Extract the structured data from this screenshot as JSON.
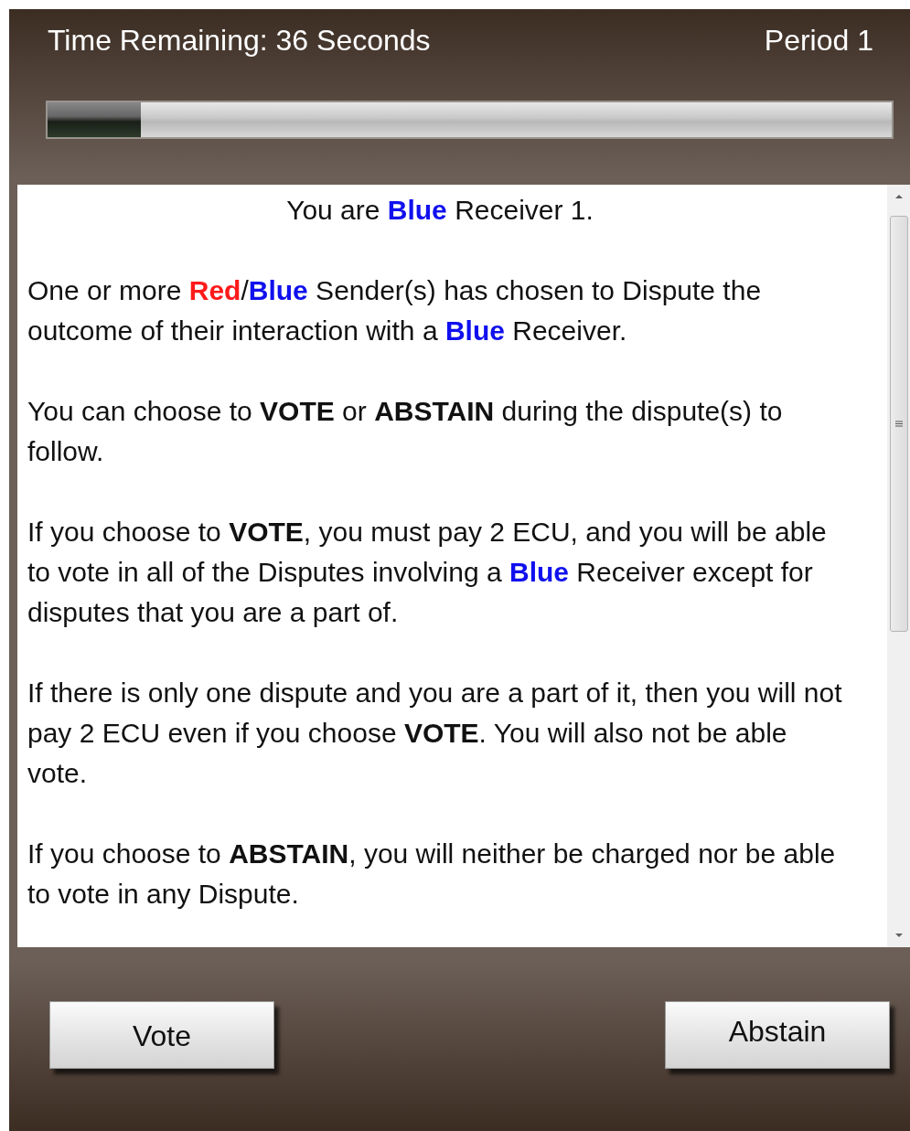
{
  "header": {
    "time_remaining": "Time Remaining: 36 Seconds",
    "period": "Period 1"
  },
  "timer": {
    "level": 0.11
  },
  "message": {
    "paragraphs": [
      {
        "kind": "heading",
        "segments": [
          {
            "kind": "plain",
            "text": "You are "
          },
          {
            "kind": "team_blue",
            "text": "Blue"
          },
          {
            "kind": "plain",
            "text": " Receiver 1."
          }
        ]
      },
      {
        "kind": "body",
        "segments": [
          {
            "kind": "plain",
            "text": "One or more "
          },
          {
            "kind": "team_red",
            "text": "Red"
          },
          {
            "kind": "plain",
            "text": "/"
          },
          {
            "kind": "team_blue",
            "text": "Blue"
          },
          {
            "kind": "plain",
            "text": " Sender(s) has chosen to Dispute the outcome of their interaction with a "
          },
          {
            "kind": "team_blue",
            "text": "Blue"
          },
          {
            "kind": "plain",
            "text": " Receiver."
          }
        ]
      },
      {
        "kind": "body",
        "segments": [
          {
            "kind": "plain",
            "text": "You can choose to "
          },
          {
            "kind": "strong",
            "text": "VOTE"
          },
          {
            "kind": "plain",
            "text": " or "
          },
          {
            "kind": "strong",
            "text": "ABSTAIN"
          },
          {
            "kind": "plain",
            "text": " during the dispute(s) to follow."
          }
        ]
      },
      {
        "kind": "body",
        "segments": [
          {
            "kind": "plain",
            "text": "If you choose to "
          },
          {
            "kind": "strong",
            "text": "VOTE"
          },
          {
            "kind": "plain",
            "text": ", you must pay 2 ECU, and you will be able to vote in all of the Disputes involving a "
          },
          {
            "kind": "team_blue",
            "text": "Blue"
          },
          {
            "kind": "plain",
            "text": " Receiver except for disputes that you are a part of."
          }
        ]
      },
      {
        "kind": "body",
        "segments": [
          {
            "kind": "plain",
            "text": "If there is only one dispute and you are a part of it, then you will not pay 2 ECU even if you choose "
          },
          {
            "kind": "strong",
            "text": "VOTE"
          },
          {
            "kind": "plain",
            "text": ". You will also not be able vote."
          }
        ]
      },
      {
        "kind": "body",
        "segments": [
          {
            "kind": "plain",
            "text": "If you choose to "
          },
          {
            "kind": "strong",
            "text": "ABSTAIN"
          },
          {
            "kind": "plain",
            "text": ", you will neither be charged nor be able to vote in any Dispute."
          }
        ]
      }
    ]
  },
  "buttons": [
    {
      "label": "Vote"
    },
    {
      "label": "Abstain"
    }
  ]
}
